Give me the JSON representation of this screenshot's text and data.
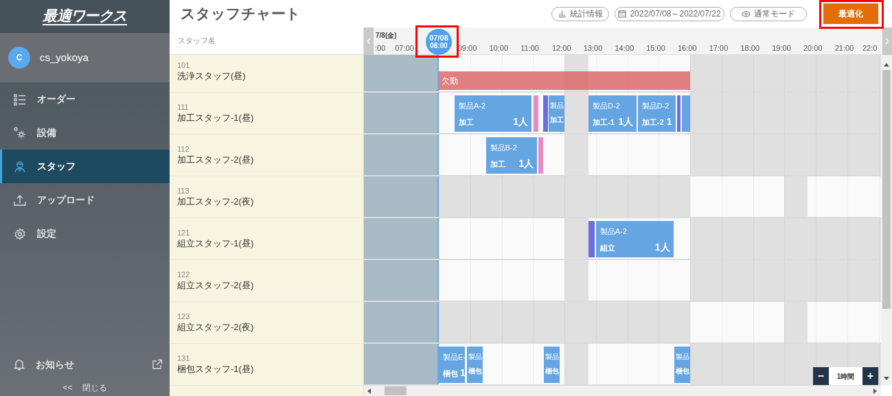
{
  "sidebar": {
    "logo": "最適ワークス",
    "user": {
      "initial": "C",
      "name": "cs_yokoya"
    },
    "menu": [
      {
        "label": "オーダー",
        "selected": false
      },
      {
        "label": "設備",
        "selected": false
      },
      {
        "label": "スタッフ",
        "selected": true
      },
      {
        "label": "アップロード",
        "selected": false
      },
      {
        "label": "設定",
        "selected": false
      }
    ],
    "notice": "お知らせ",
    "close": {
      "arrows": "<<",
      "label": "閉じる"
    }
  },
  "header": {
    "title": "スタッフチャート",
    "buttons": [
      {
        "label": "統計情報"
      },
      {
        "label": "2022/07/08～2022/07/22"
      },
      {
        "label": "通常モード"
      }
    ],
    "primary_button": {
      "label": "最適化",
      "highlighted": true
    }
  },
  "chart": {
    "name_column": "スタッフ名",
    "date": "7/8(金)",
    "hours": [
      ":00",
      "07:00",
      "09:00",
      "10:00",
      "11:00",
      "12:00",
      "13:00",
      "14:00",
      "15:00",
      "16:00",
      "17:00",
      "18:00",
      "19:00",
      "20:00",
      "21:00",
      "22:0"
    ],
    "now": {
      "date": "07/08",
      "time": "08:00",
      "highlighted": true
    },
    "zoom": {
      "minus": "−",
      "label": "1時間",
      "plus": "+"
    },
    "rows": [
      {
        "number": "101",
        "name": "洗浄スタッフ(昼)",
        "kind": "day",
        "blocks": [
          {
            "kind": "absence",
            "label": "欠勤"
          }
        ]
      },
      {
        "number": "111",
        "name": "加工スタッフ-1(昼)",
        "kind": "day",
        "blocks": [
          {
            "kind": "task",
            "product": "製品A-2",
            "process": "加工",
            "persons": "1人",
            "color": "#64a5e2"
          },
          {
            "kind": "task",
            "color": "#e88cbf"
          },
          {
            "kind": "task",
            "color": "#6a6fdc"
          },
          {
            "kind": "task",
            "product": "製品",
            "process": "加工",
            "color": "#64a5e2"
          },
          {
            "kind": "task",
            "product": "製品D-2",
            "process": "加工-1",
            "persons": "1人",
            "color": "#64a5e2"
          },
          {
            "kind": "task",
            "product": "製品D-2",
            "process": "加工-2",
            "persons": "1",
            "color": "#64a5e2"
          },
          {
            "kind": "task",
            "color": "#6a6fdc"
          },
          {
            "kind": "task",
            "color": "#64a5e2"
          }
        ]
      },
      {
        "number": "112",
        "name": "加工スタッフ-2(昼)",
        "kind": "day",
        "blocks": [
          {
            "kind": "task",
            "product": "製品B-2",
            "process": "加工",
            "persons": "1人",
            "color": "#64a5e2"
          },
          {
            "kind": "task",
            "color": "#e88cbf"
          }
        ]
      },
      {
        "number": "113",
        "name": "加工スタッフ-2(夜)",
        "kind": "night"
      },
      {
        "number": "121",
        "name": "組立スタッフ-1(昼)",
        "kind": "day",
        "blocks": [
          {
            "kind": "task",
            "color": "#6a6fdc"
          },
          {
            "kind": "task",
            "product": "製品A-2",
            "process": "組立",
            "persons": "1人",
            "color": "#64a5e2"
          }
        ]
      },
      {
        "number": "122",
        "name": "組立スタッフ-2(昼)",
        "kind": "day"
      },
      {
        "number": "123",
        "name": "組立スタッフ-2(夜)",
        "kind": "night"
      },
      {
        "number": "131",
        "name": "梱包スタッフ-1(昼)",
        "kind": "day",
        "blocks": [
          {
            "kind": "task",
            "product": "製品E-",
            "process": "梱包",
            "persons": "1",
            "color": "#64a5e2"
          },
          {
            "kind": "task",
            "product": "製品",
            "process": "梱包",
            "color": "#64a5e2"
          },
          {
            "kind": "task",
            "product": "製品",
            "process": "梱包",
            "color": "#64a5e2"
          },
          {
            "kind": "task",
            "product": "製品",
            "process": "梱包",
            "color": "#64a5e2"
          }
        ]
      }
    ]
  }
}
